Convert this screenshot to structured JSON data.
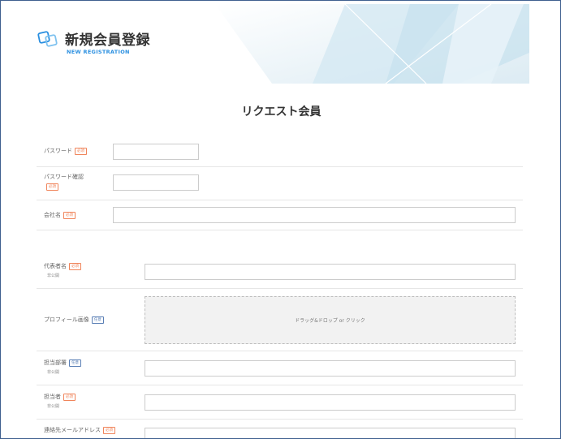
{
  "header": {
    "title": "新規会員登録",
    "subtitle": "NEW REGISTRATION"
  },
  "page_title": "リクエスト会員",
  "badges": {
    "required": "必須",
    "optional": "任意"
  },
  "fields": {
    "password": {
      "label": "パスワード"
    },
    "password_confirm": {
      "label": "パスワード確認"
    },
    "company": {
      "label": "会社名"
    },
    "representative": {
      "label": "代表者名",
      "note": "非公開"
    },
    "profile_image": {
      "label": "プロフィール画像",
      "dropzone": "ドラッグ&ドロップ or クリック"
    },
    "department": {
      "label": "担当部署",
      "note": "非公開"
    },
    "person": {
      "label": "担当者",
      "note": "非公開"
    },
    "email": {
      "label": "連絡先メールアドレス"
    }
  },
  "colors": {
    "accent": "#2a8fe0",
    "required_badge": "#f0845a",
    "optional_badge": "#5a7fb5",
    "border": "#3f5f8f"
  }
}
